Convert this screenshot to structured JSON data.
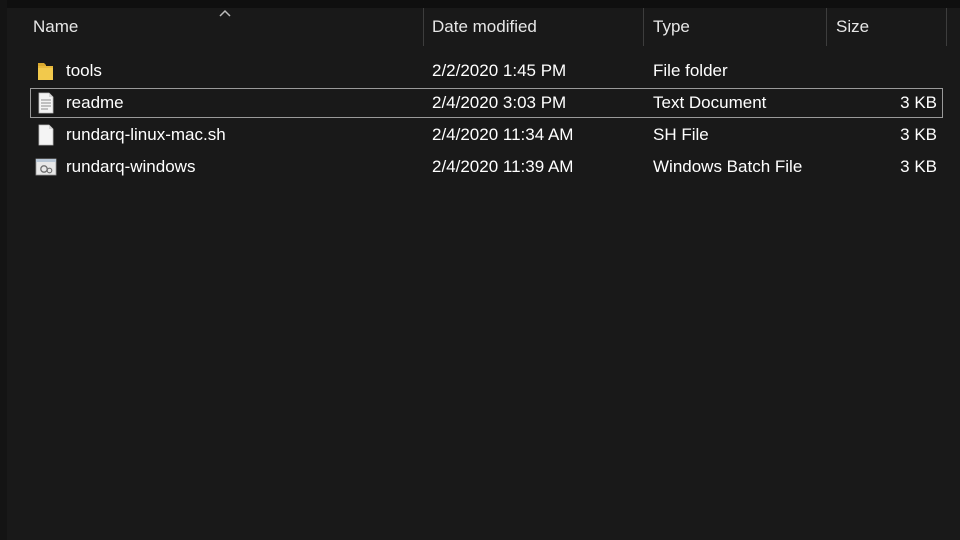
{
  "columns": {
    "name": "Name",
    "date_modified": "Date modified",
    "type": "Type",
    "size": "Size"
  },
  "sort": {
    "column": "name",
    "direction": "ascending",
    "icon": "sort-up-icon"
  },
  "files": [
    {
      "name": "tools",
      "date": "2/2/2020 1:45 PM",
      "type": "File folder",
      "size": "",
      "icon": "folder-icon"
    },
    {
      "name": "readme",
      "date": "2/4/2020 3:03 PM",
      "type": "Text Document",
      "size": "3 KB",
      "icon": "text-document-icon",
      "focused": true
    },
    {
      "name": "rundarq-linux-mac.sh",
      "date": "2/4/2020 11:34 AM",
      "type": "SH File",
      "size": "3 KB",
      "icon": "file-icon"
    },
    {
      "name": "rundarq-windows",
      "date": "2/4/2020 11:39 AM",
      "type": "Windows Batch File",
      "size": "3 KB",
      "icon": "batch-file-icon"
    }
  ],
  "colors": {
    "background": "#191919",
    "text": "#ffffff",
    "header_text": "#e6e6e6",
    "separator": "#3d3d3d",
    "focus_border": "#9a9a9a",
    "folder": "#f2c94c"
  }
}
